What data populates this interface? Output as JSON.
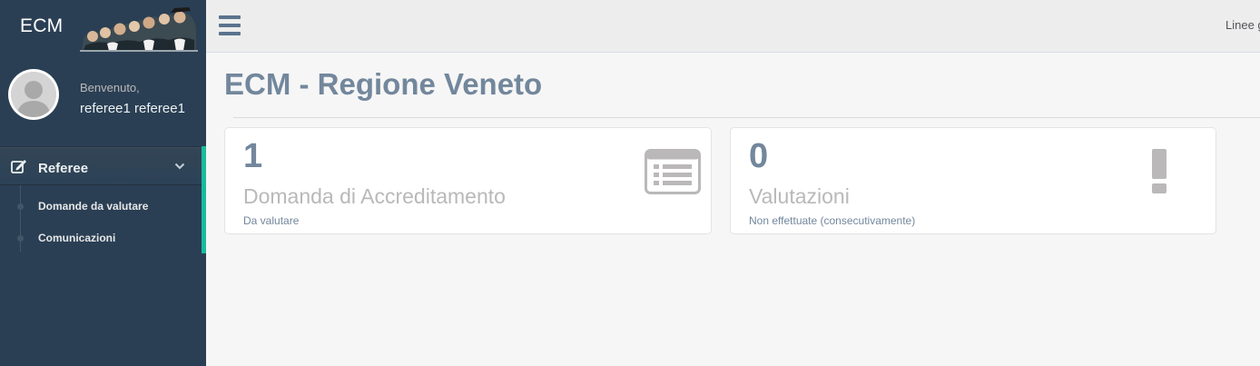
{
  "sidebar": {
    "brand": "ECM",
    "welcome": "Benvenuto,",
    "user_name": "referee1 referee1",
    "menu": {
      "label": "Referee",
      "icon": "edit-icon",
      "items": [
        {
          "label": "Domande da valutare"
        },
        {
          "label": "Comunicazioni"
        }
      ]
    }
  },
  "topnav": {
    "right_text": "Linee g"
  },
  "main": {
    "title": "ECM - Regione Veneto",
    "tiles": [
      {
        "count": "1",
        "label": "Domanda di Accreditamento",
        "sublabel": "Da valutare",
        "icon": "list-alt-icon"
      },
      {
        "count": "0",
        "label": "Valutazioni",
        "sublabel": "Non effettuate (consecutivamente)",
        "icon": "exclamation-icon"
      }
    ]
  },
  "colors": {
    "sidebar_bg": "#2a3f54",
    "accent": "#1abb9c",
    "title": "#73879c",
    "icon_gray": "#bab8b8"
  }
}
